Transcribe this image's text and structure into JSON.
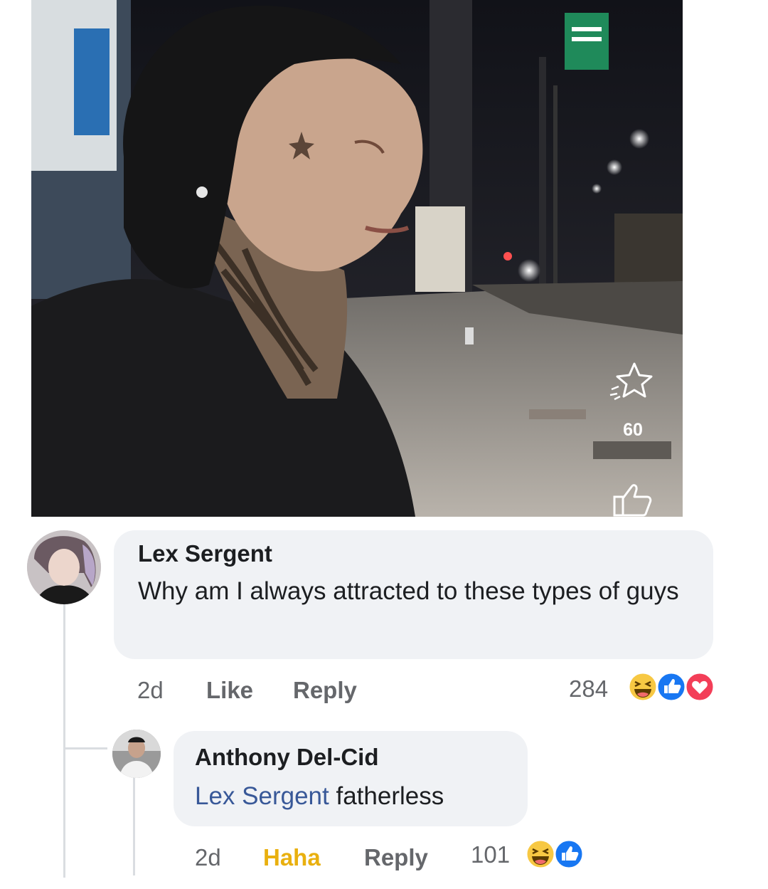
{
  "video": {
    "star_icon": "star-sparkle-icon",
    "star_count": "60",
    "like_icon": "thumbs-up-outline-icon"
  },
  "comments": [
    {
      "author": "Lex Sergent",
      "text": "Why am I always attracted to these types of guys",
      "time": "2d",
      "like_label": "Like",
      "reply_label": "Reply",
      "reaction_count": "284",
      "reactions": [
        "haha",
        "like",
        "love"
      ]
    }
  ],
  "reply": {
    "author": "Anthony Del-Cid",
    "mention": "Lex Sergent",
    "text": "fatherless",
    "time": "2d",
    "reaction_label": "Haha",
    "reply_label": "Reply",
    "reaction_count": "101",
    "reactions": [
      "haha",
      "like"
    ]
  },
  "colors": {
    "bubble": "#f0f2f5",
    "meta": "#65676b",
    "mention": "#385898",
    "haha": "#e9b00f",
    "like_blue": "#1877f2",
    "love_red": "#f33e58"
  }
}
